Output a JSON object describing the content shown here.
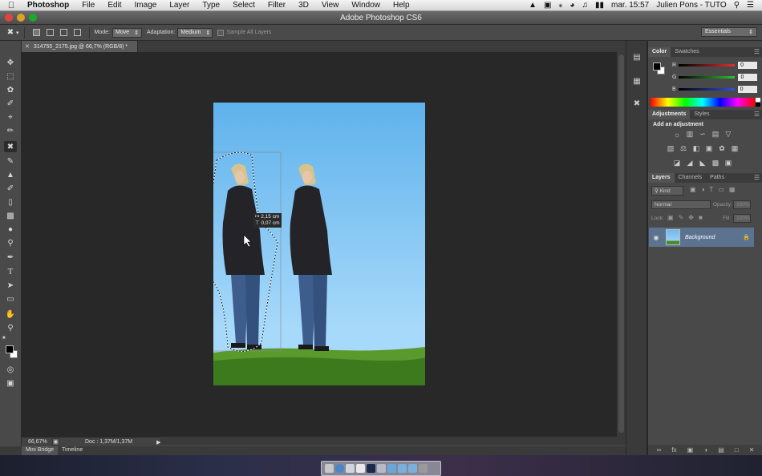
{
  "menubar": {
    "app_name": "Photoshop",
    "items": [
      "File",
      "Edit",
      "Image",
      "Layer",
      "Type",
      "Select",
      "Filter",
      "3D",
      "View",
      "Window",
      "Help"
    ],
    "clock": "mar. 15:57",
    "user": "Julien Pons - TUTO"
  },
  "window": {
    "title": "Adobe Photoshop CS6"
  },
  "options": {
    "mode_label": "Mode:",
    "mode_value": "Move",
    "adaptation_label": "Adaptation:",
    "adaptation_value": "Medium",
    "sample_all_layers": "Sample All Layers",
    "workspace": "Essentials"
  },
  "document": {
    "tab_title": "314755_2175.jpg @ 66,7% (RGB/8) *",
    "measure_w": "2,15 cm",
    "measure_h": "0,07 cm"
  },
  "status": {
    "zoom": "66,67%",
    "doc": "Doc : 1,37M/1,37M"
  },
  "bottom_tabs": [
    "Mini Bridge",
    "Timeline"
  ],
  "color_panel": {
    "tabs": [
      "Color",
      "Swatches"
    ],
    "channels": [
      {
        "label": "R",
        "value": "0",
        "color": "#e04040"
      },
      {
        "label": "G",
        "value": "0",
        "color": "#30c030"
      },
      {
        "label": "B",
        "value": "0",
        "color": "#3050e0"
      }
    ]
  },
  "adjustments_panel": {
    "tabs": [
      "Adjustments",
      "Styles"
    ],
    "heading": "Add an adjustment"
  },
  "layers_panel": {
    "tabs": [
      "Layers",
      "Channels",
      "Paths"
    ],
    "kind": "Kind",
    "blend_mode": "Normal",
    "opacity_label": "Opacity:",
    "opacity_value": "100%",
    "lock_label": "Lock:",
    "fill_label": "Fill:",
    "fill_value": "100%",
    "layer_name": "Background"
  }
}
